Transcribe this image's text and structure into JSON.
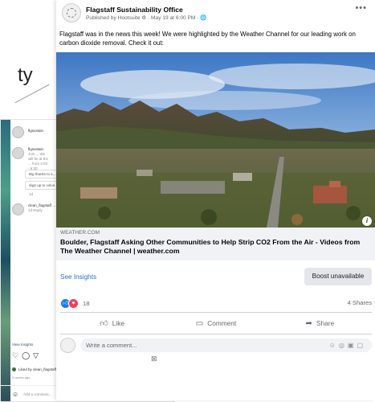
{
  "background": {
    "fragment_text": "ty"
  },
  "instagram": {
    "comments": [
      {
        "user": "flgsustain",
        "text": ""
      },
      {
        "user": "flgsustain",
        "text": "Join ... We will be at the ... from 4:00 - 6:30"
      }
    ],
    "replies": [
      "Big thanks to s...",
      "Sign up to volun..."
    ],
    "meta_short": "1d",
    "reply_comment": {
      "user": "clean_flagstaff",
      "text": "...",
      "meta": "1d  Reply"
    },
    "view_insights": "View Insights",
    "liked_by": "Liked by clean_flagstaff_project and 52 others",
    "time": "3 weeks ago",
    "add_comment": "Add a comment...",
    "post_label": "Post"
  },
  "post": {
    "page_name": "Flagstaff Sustainability Office",
    "meta": "Published by Hootsuite ⚙ · May 19 at 6:00 PM · 🌐",
    "more": "•••",
    "body": "Flagstaff was in the news this week! We were highlighted by the Weather Channel for our leading work on carbon dioxide removal. Check it out:",
    "link": {
      "domain": "WEATHER.COM",
      "headline": "Boulder, Flagstaff Asking Other Communities to Help Strip CO2 From the Air - Videos from The Weather Channel | weather.com"
    },
    "see_insights": "See Insights",
    "boost": "Boost unavailable",
    "reaction_count": "18",
    "shares": "4 Shares",
    "actions": {
      "like": "Like",
      "comment": "Comment",
      "share": "Share"
    },
    "comment_placeholder": "Write a comment..."
  },
  "colors": {
    "facebook_blue": "#1877f2",
    "love_red": "#f33e58",
    "link_bg": "#f0f2f5"
  }
}
